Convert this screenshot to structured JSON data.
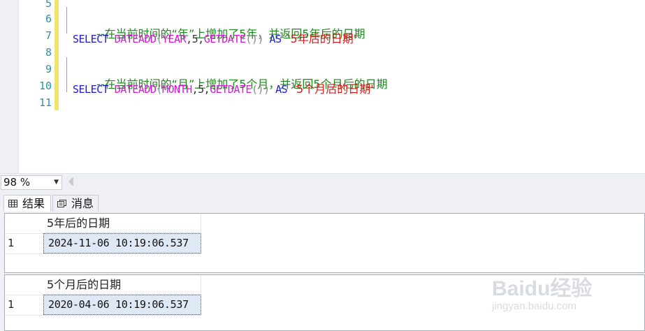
{
  "editor": {
    "line_numbers": [
      "5",
      "6",
      "7",
      "8",
      "9",
      "10",
      "11"
    ],
    "line6_comment": "--在当前时间的“年”上增加了5年，并返回5年后的日期",
    "line7": {
      "select": "SELECT",
      "dateadd": "DATEADD",
      "open": "(",
      "part": "YEAR",
      "args": ",5,",
      "getdate": "GETDATE",
      "parens": "())",
      "as": "AS",
      "alias": "'5年后的日期'"
    },
    "line9_comment": "--在当前时间的“月”上增加了5个月，并返回5个月后的日期",
    "line10": {
      "select": "SELECT",
      "dateadd": "DATEADD",
      "open": "(",
      "part": "MONTH",
      "args": ",5,",
      "getdate": "GETDATE",
      "parens": "())",
      "as": "AS",
      "alias": "'5个月后的日期'"
    }
  },
  "zoom": {
    "value": "98 %"
  },
  "results_tabs": {
    "results_label": "结果",
    "messages_label": "消息"
  },
  "grids": [
    {
      "column": "5年后的日期",
      "row_number": "1",
      "value": "2024-11-06 10:19:06.537"
    },
    {
      "column": "5个月后的日期",
      "row_number": "1",
      "value": "2020-04-06 10:19:06.537"
    }
  ],
  "watermark": {
    "brand": "Baidu经验",
    "url": "jingyan.baidu.com"
  },
  "colors": {
    "comment": "#1a8a1a",
    "keyword": "#1b1bd8",
    "function": "#d11ad1",
    "string": "#cc1f1f",
    "line_number": "#2b91af",
    "change_bar": "#f2e36a"
  }
}
